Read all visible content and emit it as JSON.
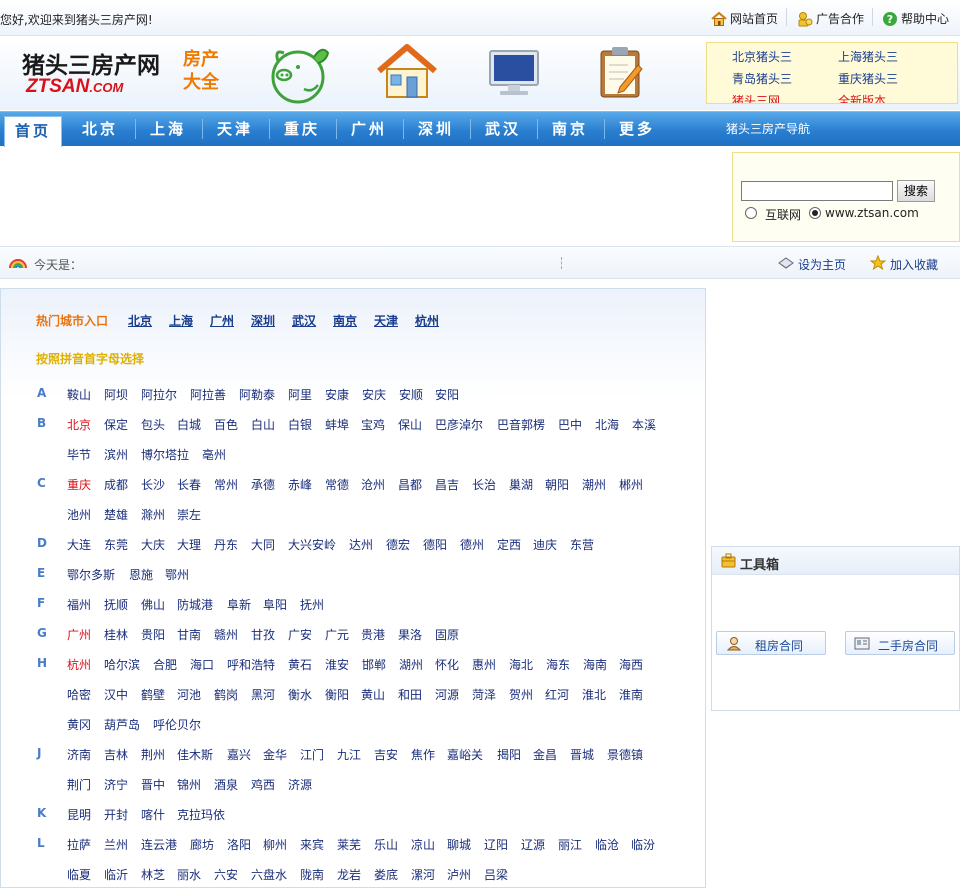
{
  "topbar": {
    "welcome": "您好,欢迎来到猪头三房产网!",
    "links": [
      "网站首页",
      "广告合作",
      "帮助中心"
    ]
  },
  "header": {
    "logo_cn": "猪头三房产网",
    "logo_en_main": "ZTSAN",
    "logo_en_suffix": ".COM",
    "slogan_line1": "房产",
    "slogan_line2": "大全",
    "city_links": [
      "北京猪头三",
      "上海猪头三",
      "青岛猪头三",
      "重庆猪头三",
      "猪头三网",
      "全新版本"
    ]
  },
  "nav": {
    "home": "首页",
    "items": [
      "北京",
      "上海",
      "天津",
      "重庆",
      "广州",
      "深圳",
      "武汉",
      "南京",
      "更多"
    ],
    "guide": "猪头三房产导航"
  },
  "search": {
    "button": "搜索",
    "value": "",
    "option_web": "互联网",
    "option_site": "www.ztsan.com"
  },
  "datebar": {
    "today": "今天是：",
    "set_home": "设为主页",
    "add_fav": "加入收藏"
  },
  "main": {
    "hot_label": "热门城市入口",
    "hot_cities": [
      "北京",
      "上海",
      "广州",
      "深圳",
      "武汉",
      "南京",
      "天津",
      "杭州"
    ],
    "pinyin_label": "按照拼音首字母选择",
    "groups": [
      {
        "letter": "A",
        "rows": [
          [
            "鞍山",
            "阿坝",
            "阿拉尔",
            "阿拉善",
            "阿勒泰",
            "阿里",
            "安康",
            "安庆",
            "安顺",
            "安阳"
          ]
        ]
      },
      {
        "letter": "B",
        "rows": [
          [
            "北京",
            "保定",
            "包头",
            "白城",
            "百色",
            "白山",
            "白银",
            "蚌埠",
            "宝鸡",
            "保山",
            "巴彦淖尔",
            "巴音郭楞",
            "巴中",
            "北海",
            "本溪"
          ],
          [
            "毕节",
            "滨州",
            "博尔塔拉",
            "亳州"
          ]
        ]
      },
      {
        "letter": "C",
        "rows": [
          [
            "重庆",
            "成都",
            "长沙",
            "长春",
            "常州",
            "承德",
            "赤峰",
            "常德",
            "沧州",
            "昌都",
            "昌吉",
            "长治",
            "巢湖",
            "朝阳",
            "潮州",
            "郴州"
          ],
          [
            "池州",
            "楚雄",
            "滁州",
            "崇左"
          ]
        ]
      },
      {
        "letter": "D",
        "rows": [
          [
            "大连",
            "东莞",
            "大庆",
            "大理",
            "丹东",
            "大同",
            "大兴安岭",
            "达州",
            "德宏",
            "德阳",
            "德州",
            "定西",
            "迪庆",
            "东营"
          ]
        ]
      },
      {
        "letter": "E",
        "rows": [
          [
            "鄂尔多斯",
            "恩施",
            "鄂州"
          ]
        ]
      },
      {
        "letter": "F",
        "rows": [
          [
            "福州",
            "抚顺",
            "佛山",
            "防城港",
            "阜新",
            "阜阳",
            "抚州"
          ]
        ]
      },
      {
        "letter": "G",
        "rows": [
          [
            "广州",
            "桂林",
            "贵阳",
            "甘南",
            "赣州",
            "甘孜",
            "广安",
            "广元",
            "贵港",
            "果洛",
            "固原"
          ]
        ]
      },
      {
        "letter": "H",
        "rows": [
          [
            "杭州",
            "哈尔滨",
            "合肥",
            "海口",
            "呼和浩特",
            "黄石",
            "淮安",
            "邯郸",
            "湖州",
            "怀化",
            "惠州",
            "海北",
            "海东",
            "海南",
            "海西"
          ],
          [
            "哈密",
            "汉中",
            "鹤壁",
            "河池",
            "鹤岗",
            "黑河",
            "衡水",
            "衡阳",
            "黄山",
            "和田",
            "河源",
            "菏泽",
            "贺州",
            "红河",
            "淮北",
            "淮南"
          ],
          [
            "黄冈",
            "葫芦岛",
            "呼伦贝尔"
          ]
        ]
      },
      {
        "letter": "J",
        "rows": [
          [
            "济南",
            "吉林",
            "荆州",
            "佳木斯",
            "嘉兴",
            "金华",
            "江门",
            "九江",
            "吉安",
            "焦作",
            "嘉峪关",
            "揭阳",
            "金昌",
            "晋城",
            "景德镇"
          ],
          [
            "荆门",
            "济宁",
            "晋中",
            "锦州",
            "酒泉",
            "鸡西",
            "济源"
          ]
        ]
      },
      {
        "letter": "K",
        "rows": [
          [
            "昆明",
            "开封",
            "喀什",
            "克拉玛依"
          ]
        ]
      },
      {
        "letter": "L",
        "rows": [
          [
            "拉萨",
            "兰州",
            "连云港",
            "廊坊",
            "洛阳",
            "柳州",
            "来宾",
            "莱芜",
            "乐山",
            "凉山",
            "聊城",
            "辽阳",
            "辽源",
            "丽江",
            "临沧",
            "临汾"
          ],
          [
            "临夏",
            "临沂",
            "林芝",
            "丽水",
            "六安",
            "六盘水",
            "陇南",
            "龙岩",
            "娄底",
            "漯河",
            "泸州",
            "吕梁"
          ]
        ]
      }
    ]
  },
  "toolbox": {
    "title": "工具箱",
    "buttons": [
      "租房合同",
      "二手房合同"
    ]
  }
}
